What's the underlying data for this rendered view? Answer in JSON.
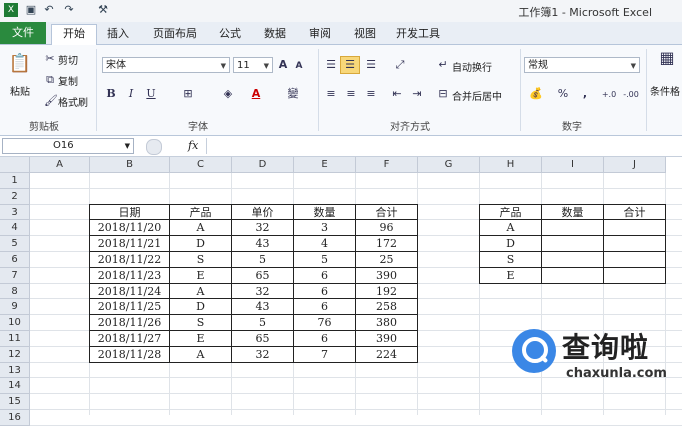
{
  "window": {
    "title": "工作簿1 - Microsoft Excel"
  },
  "tabs": [
    "文件",
    "开始",
    "插入",
    "页面布局",
    "公式",
    "数据",
    "审阅",
    "视图",
    "开发工具"
  ],
  "clipboard": {
    "paste": "粘贴",
    "cut": "剪切",
    "copy": "复制",
    "format_painter": "格式刷",
    "label": "剪贴板"
  },
  "font": {
    "name": "宋体",
    "size": "11",
    "label": "字体",
    "bold": "B",
    "italic": "I",
    "underline": "U",
    "grow": "A",
    "shrink": "A",
    "wen": "變"
  },
  "alignment": {
    "wrap": "自动换行",
    "merge": "合并后居中",
    "label": "对齐方式"
  },
  "number": {
    "format": "常规",
    "percent": "%",
    "comma": ",",
    "label": "数字",
    "inc": "+.0",
    "dec": "-.00"
  },
  "styles": {
    "conditional": "条件格"
  },
  "formula_bar": {
    "name_box": "O16",
    "fx": "fx",
    "value": ""
  },
  "columns": [
    "A",
    "B",
    "C",
    "D",
    "E",
    "F",
    "G",
    "H",
    "I",
    "J"
  ],
  "rows": [
    "1",
    "2",
    "3",
    "4",
    "5",
    "6",
    "7",
    "8",
    "9",
    "10",
    "11",
    "12",
    "13",
    "14",
    "15",
    "16"
  ],
  "table1": {
    "headers": [
      "日期",
      "产品",
      "单价",
      "数量",
      "合计"
    ],
    "rows": [
      [
        "2018/11/20",
        "A",
        "32",
        "3",
        "96"
      ],
      [
        "2018/11/21",
        "D",
        "43",
        "4",
        "172"
      ],
      [
        "2018/11/22",
        "S",
        "5",
        "5",
        "25"
      ],
      [
        "2018/11/23",
        "E",
        "65",
        "6",
        "390"
      ],
      [
        "2018/11/24",
        "A",
        "32",
        "6",
        "192"
      ],
      [
        "2018/11/25",
        "D",
        "43",
        "6",
        "258"
      ],
      [
        "2018/11/26",
        "S",
        "5",
        "76",
        "380"
      ],
      [
        "2018/11/27",
        "E",
        "65",
        "6",
        "390"
      ],
      [
        "2018/11/28",
        "A",
        "32",
        "7",
        "224"
      ]
    ]
  },
  "table2": {
    "headers": [
      "产品",
      "数量",
      "合计"
    ],
    "rows": [
      [
        "A",
        "",
        ""
      ],
      [
        "D",
        "",
        ""
      ],
      [
        "S",
        "",
        ""
      ],
      [
        "E",
        "",
        ""
      ]
    ]
  },
  "watermark": {
    "brand": "查询啦",
    "domain": "chaxunla.com"
  },
  "colors": {
    "file_tab": "#2a8a3e",
    "header_bg": "#e4e9f0",
    "watermark_blue": "#3a87e6"
  }
}
